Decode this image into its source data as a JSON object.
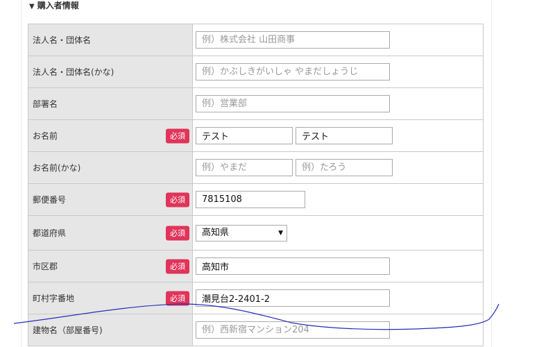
{
  "section": {
    "title": "購入者情報",
    "toggle_icon": "triangle-down-icon"
  },
  "badge_text": "必須",
  "rows": {
    "corp_name": {
      "label": "法人名・団体名",
      "placeholder": "例）株式会社 山田商事",
      "value": ""
    },
    "corp_kana": {
      "label": "法人名・団体名(かな)",
      "placeholder": "例）かぶしきがいしゃ やまだしょうじ",
      "value": ""
    },
    "department": {
      "label": "部署名",
      "placeholder": "例）営業部",
      "value": ""
    },
    "name": {
      "label": "お名前",
      "last": "テスト",
      "first": "テスト"
    },
    "name_kana": {
      "label": "お名前(かな)",
      "last_placeholder": "例）やまだ",
      "first_placeholder": "例）たろう"
    },
    "postal": {
      "label": "郵便番号",
      "value": "7815108"
    },
    "prefecture": {
      "label": "都道府県",
      "selected": "高知県"
    },
    "city": {
      "label": "市区郡",
      "value": "高知市"
    },
    "address": {
      "label": "町村字番地",
      "value": "潮見台2-2401-2"
    },
    "building": {
      "label": "建物名（部屋番号)",
      "placeholder": "例）西新宿マンション204",
      "value": ""
    }
  },
  "annotation_color": "#1f2fb5"
}
